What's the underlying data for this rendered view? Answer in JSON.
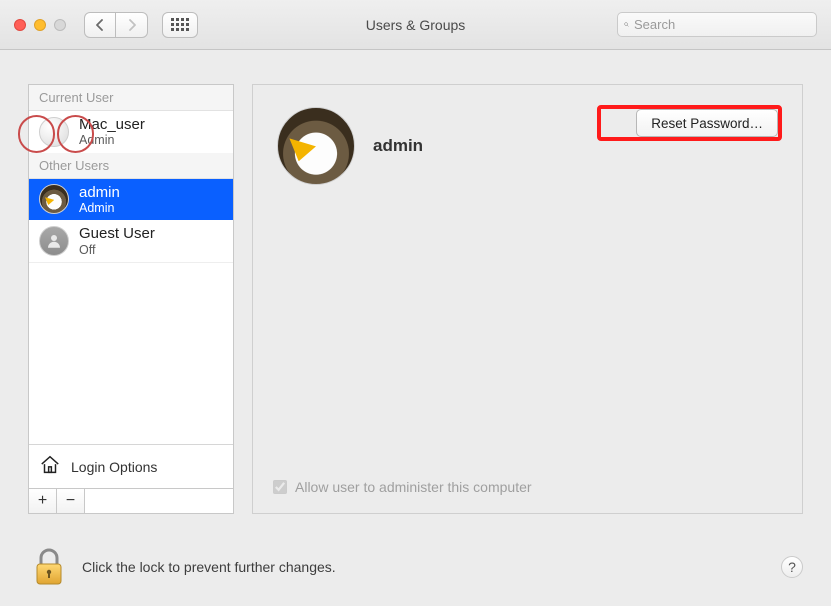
{
  "window": {
    "title": "Users & Groups"
  },
  "search": {
    "placeholder": "Search"
  },
  "sidebar": {
    "sections": [
      {
        "header": "Current User",
        "items": [
          {
            "name": "Mac_user",
            "role": "Admin",
            "avatar": "baseball"
          }
        ]
      },
      {
        "header": "Other Users",
        "items": [
          {
            "name": "admin",
            "role": "Admin",
            "avatar": "eagle",
            "selected": true
          },
          {
            "name": "Guest User",
            "role": "Off",
            "avatar": "guest"
          }
        ]
      }
    ],
    "login_options_label": "Login Options"
  },
  "detail": {
    "user_name": "admin",
    "reset_label": "Reset Password…",
    "admin_checkbox_label": "Allow user to administer this computer",
    "admin_checked": true
  },
  "footer": {
    "lock_text": "Click the lock to prevent further changes.",
    "help_label": "?"
  }
}
